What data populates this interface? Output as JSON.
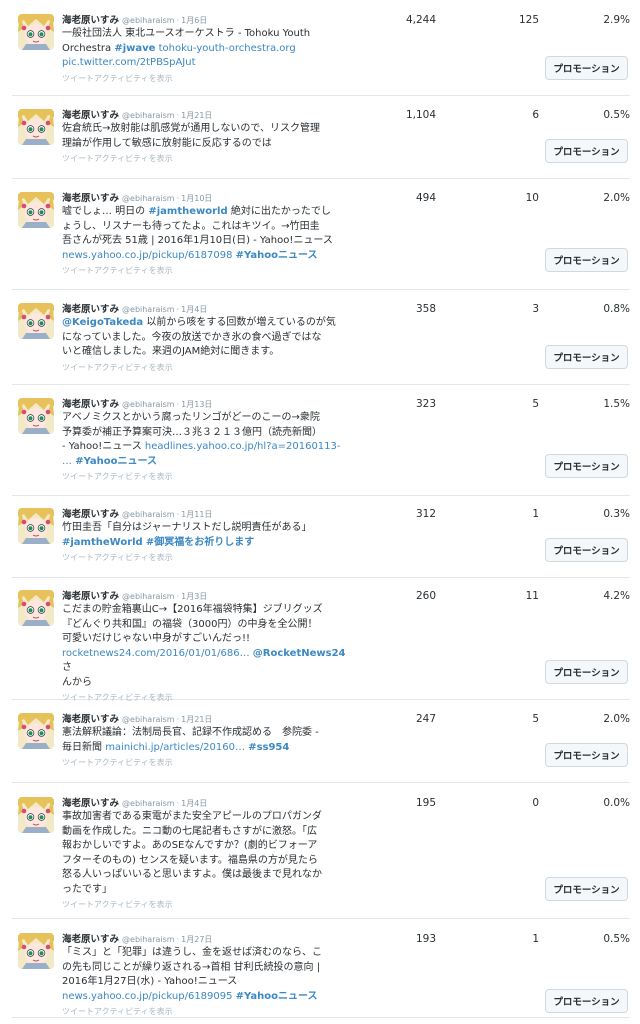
{
  "tweets": [
    {
      "name": "海老原いすみ",
      "handle": "@ebiharaism",
      "date": "1月6日",
      "lines": [
        [
          {
            "t": "一般社団法人 東北ユースオーケストラ - Tohoku Youth"
          }
        ],
        [
          {
            "t": "Orchestra "
          },
          {
            "t": "#jwave",
            "k": "tag"
          },
          {
            "t": " tohoku-youth-orchestra.org",
            "k": "link"
          }
        ],
        [
          {
            "t": "pic.twitter.com/2tPBSpAJut",
            "k": "link"
          }
        ]
      ],
      "activity": "ツイートアクティビティを表示",
      "impressions": "4,244",
      "engagements": "125",
      "rate": "2.9%",
      "promote": "プロモーション"
    },
    {
      "name": "海老原いすみ",
      "handle": "@ebiharaism",
      "date": "1月21日",
      "lines": [
        [
          {
            "t": "佐倉統氏→放射能は肌感覚が通用しないので、リスク管理"
          }
        ],
        [
          {
            "t": "理論が作用して敏感に放射能に反応するのでは"
          }
        ]
      ],
      "activity": "ツイートアクティビティを表示",
      "impressions": "1,104",
      "engagements": "6",
      "rate": "0.5%",
      "promote": "プロモーション"
    },
    {
      "name": "海老原いすみ",
      "handle": "@ebiharaism",
      "date": "1月10日",
      "lines": [
        [
          {
            "t": "嘘でしょ… 明日の "
          },
          {
            "t": "#jamtheworld",
            "k": "tag"
          },
          {
            "t": " 絶対に出たかったでし"
          }
        ],
        [
          {
            "t": "ょうし、リスナーも待ってたよ。これはキツイ。→竹田圭"
          }
        ],
        [
          {
            "t": "吾さんが死去 51歳 | 2016年1月10日(日) - Yahoo!ニュース"
          }
        ],
        [
          {
            "t": "news.yahoo.co.jp/pickup/6187098 ",
            "k": "link"
          },
          {
            "t": "#Yahooニュース",
            "k": "tag"
          }
        ]
      ],
      "activity": "ツイートアクティビティを表示",
      "impressions": "494",
      "engagements": "10",
      "rate": "2.0%",
      "promote": "プロモーション"
    },
    {
      "name": "海老原いすみ",
      "handle": "@ebiharaism",
      "date": "1月4日",
      "lines": [
        [
          {
            "t": "@KeigoTakeda",
            "k": "tag"
          },
          {
            "t": " 以前から咳をする回数が増えているのが気"
          }
        ],
        [
          {
            "t": "になっていました。今夜の放送でかき氷の食べ過ぎではな"
          }
        ],
        [
          {
            "t": "いと確信しました。来週のJAM絶対に聞きます。"
          }
        ]
      ],
      "activity": "ツイートアクティビティを表示",
      "impressions": "358",
      "engagements": "3",
      "rate": "0.8%",
      "promote": "プロモーション"
    },
    {
      "name": "海老原いすみ",
      "handle": "@ebiharaism",
      "date": "1月13日",
      "lines": [
        [
          {
            "t": "アベノミクスとかいう腐ったリンゴがどーのこーの→衆院"
          }
        ],
        [
          {
            "t": "予算委が補正予算案可決…３兆３２１３億円（読売新聞）"
          }
        ],
        [
          {
            "t": "- Yahoo!ニュース "
          },
          {
            "t": "headlines.yahoo.co.jp/hl?a=20160113-",
            "k": "link"
          }
        ],
        [
          {
            "t": "… ",
            "k": "link"
          },
          {
            "t": "#Yahooニュース",
            "k": "tag"
          }
        ]
      ],
      "activity": "ツイートアクティビティを表示",
      "impressions": "323",
      "engagements": "5",
      "rate": "1.5%",
      "promote": "プロモーション"
    },
    {
      "name": "海老原いすみ",
      "handle": "@ebiharaism",
      "date": "1月11日",
      "lines": [
        [
          {
            "t": "竹田圭吾「自分はジャーナリストだし説明責任がある」"
          }
        ],
        [
          {
            "t": "#jamtheWorld",
            "k": "tag"
          },
          {
            "t": " "
          },
          {
            "t": "#御冥福をお祈りします",
            "k": "tag"
          }
        ]
      ],
      "activity": "ツイートアクティビティを表示",
      "impressions": "312",
      "engagements": "1",
      "rate": "0.3%",
      "promote": "プロモーション"
    },
    {
      "name": "海老原いすみ",
      "handle": "@ebiharaism",
      "date": "1月3日",
      "lines": [
        [
          {
            "t": "こだまの貯金箱裏山C→【2016年福袋特集】ジブリグッズ"
          }
        ],
        [
          {
            "t": "『どんぐり共和国』の福袋（3000円）の中身を全公開！"
          }
        ],
        [
          {
            "t": "可愛いだけじゃない中身がすごいんだっ!!"
          }
        ],
        [
          {
            "t": "rocketnews24.com/2016/01/01/686… ",
            "k": "link"
          },
          {
            "t": "@RocketNews24",
            "k": "tag"
          },
          {
            "t": "さ"
          }
        ],
        [
          {
            "t": "んから"
          }
        ]
      ],
      "activity": "ツイートアクティビティを表示",
      "impressions": "260",
      "engagements": "11",
      "rate": "4.2%",
      "promote": "プロモーション"
    },
    {
      "name": "海老原いすみ",
      "handle": "@ebiharaism",
      "date": "1月21日",
      "lines": [
        [
          {
            "t": "憲法解釈議論：法制局長官、記録不作成認める　参院委 -"
          }
        ],
        [
          {
            "t": "毎日新聞 "
          },
          {
            "t": "mainichi.jp/articles/20160… ",
            "k": "link"
          },
          {
            "t": "#ss954",
            "k": "tag"
          }
        ]
      ],
      "activity": "ツイートアクティビティを表示",
      "impressions": "247",
      "engagements": "5",
      "rate": "2.0%",
      "promote": "プロモーション"
    },
    {
      "name": "海老原いすみ",
      "handle": "@ebiharaism",
      "date": "1月4日",
      "lines": [
        [
          {
            "t": "事故加害者である東電がまた安全アピールのプロパガンダ"
          }
        ],
        [
          {
            "t": "動画を作成した。ニコ動の七尾記者もさすがに激怒。「広"
          }
        ],
        [
          {
            "t": "報おかしいですよ。あのSEなんですか？(劇的ビフォーア"
          }
        ],
        [
          {
            "t": "フターそのもの) センスを疑います。福島県の方が見たら"
          }
        ],
        [
          {
            "t": "怒る人いっぱいいると思いますよ。僕は最後まで見れなか"
          }
        ],
        [
          {
            "t": "ったです」"
          }
        ]
      ],
      "activity": "ツイートアクティビティを表示",
      "impressions": "195",
      "engagements": "0",
      "rate": "0.0%",
      "promote": "プロモーション"
    },
    {
      "name": "海老原いすみ",
      "handle": "@ebiharaism",
      "date": "1月27日",
      "lines": [
        [
          {
            "t": "「ミス」と「犯罪」は違うし、金を返せば済むのなら、こ"
          }
        ],
        [
          {
            "t": "の先も同じことが繰り返される→首相 甘利氏続投の意向 |"
          }
        ],
        [
          {
            "t": "2016年1月27日(水) - Yahoo!ニュース"
          }
        ],
        [
          {
            "t": "news.yahoo.co.jp/pickup/6189095 ",
            "k": "link"
          },
          {
            "t": "#Yahooニュース",
            "k": "tag"
          }
        ]
      ],
      "activity": "ツイートアクティビティを表示",
      "impressions": "193",
      "engagements": "1",
      "rate": "0.5%",
      "promote": "プロモーション"
    }
  ]
}
